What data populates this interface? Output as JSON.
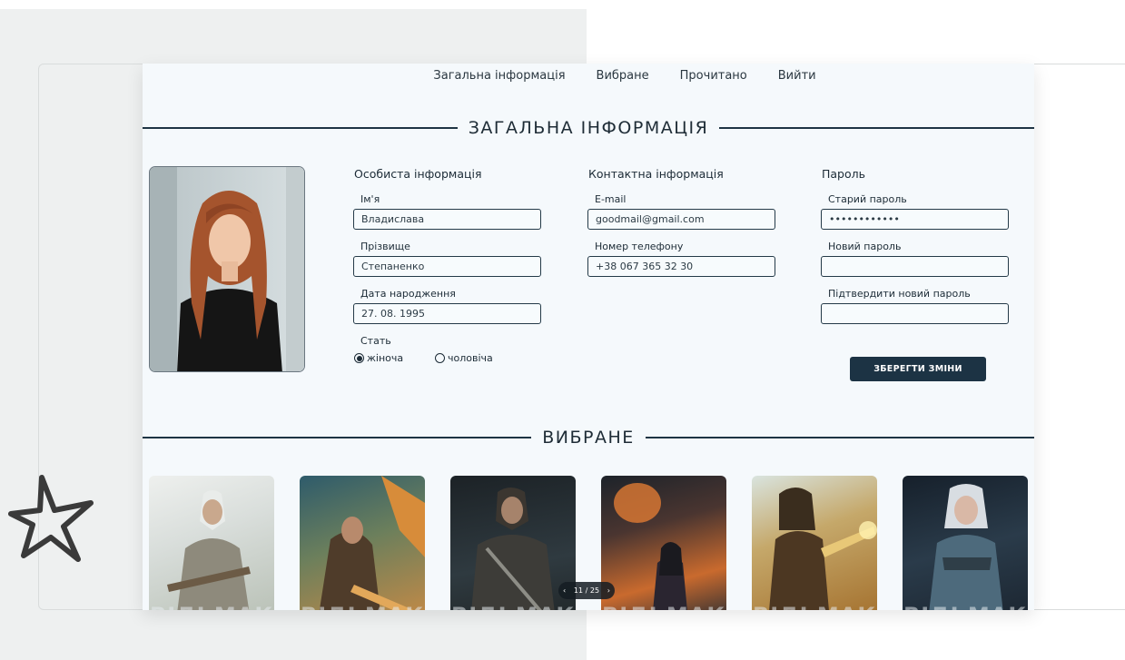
{
  "nav": {
    "items": [
      "Загальна інформація",
      "Вибране",
      "Прочитано",
      "Вийти"
    ]
  },
  "sections": {
    "general_title": "ЗАГАЛЬНА ІНФОРМАЦІЯ",
    "favorites_title": "ВИБРАНЕ"
  },
  "personal": {
    "heading": "Особиста інформація",
    "first_name_label": "Ім'я",
    "first_name_value": "Владислава",
    "last_name_label": "Прізвище",
    "last_name_value": "Степаненко",
    "birth_label": "Дата народження",
    "birth_value": "27. 08. 1995",
    "gender_label": "Стать",
    "gender_female": "жіноча",
    "gender_male": "чоловіча"
  },
  "contact": {
    "heading": "Контактна інформація",
    "email_label": "E-mail",
    "email_value": "goodmail@gmail.com",
    "phone_label": "Номер телефону",
    "phone_value": "+38 067 365 32 30"
  },
  "password": {
    "heading": "Пароль",
    "old_label": "Старий пароль",
    "old_value": "••••••••••••",
    "new_label": "Новий пароль",
    "confirm_label": "Підтвердити новий пароль"
  },
  "save_button": "ЗБЕРЕГТИ ЗМІНИ",
  "favorites": {
    "caption": "ВІДЬМАК"
  },
  "pager": {
    "prev": "‹",
    "text": "11 / 25",
    "next": "›"
  },
  "colors": {
    "accent": "#1c3344",
    "page_bg": "#f5f9fc"
  }
}
